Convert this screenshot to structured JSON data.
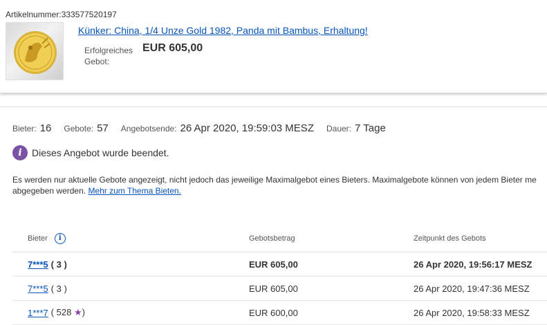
{
  "item": {
    "number_label": "Artikelnummer:",
    "number": "333577520197",
    "title": "Künker: China, 1/4 Unze Gold 1982, Panda mit Bambus, Erhaltung!",
    "winning_label": "Erfolgreiches Gebot:",
    "winning_price": "EUR 605,00"
  },
  "stats": {
    "bidders_label": "Bieter:",
    "bidders": "16",
    "bids_label": "Gebote:",
    "bids": "57",
    "end_label": "Angebotsende:",
    "end": "26 Apr 2020, 19:59:03 MESZ",
    "duration_label": "Dauer:",
    "duration": "7 Tage"
  },
  "ended_message": "Dieses Angebot wurde beendet.",
  "notice": {
    "line1": "Es werden nur aktuelle Gebote angezeigt, nicht jedoch das jeweilige Maximalgebot eines Bieters. Maximalgebote können von jedem Bieter me",
    "line2": "abgegeben werden.",
    "link": "Mehr zum Thema Bieten."
  },
  "table": {
    "headers": {
      "bidder": "Bieter",
      "amount": "Gebotsbetrag",
      "time": "Zeitpunkt des Gebots"
    },
    "rows": [
      {
        "bidder": "7***5",
        "score_open": "(",
        "score": "3",
        "score_close": ")",
        "star": "",
        "amount": "EUR 605,00",
        "time": "26 Apr 2020, 19:56:17 MESZ"
      },
      {
        "bidder": "7***5",
        "score_open": "(",
        "score": "3",
        "score_close": ")",
        "star": "",
        "amount": "EUR 605,00",
        "time": "26 Apr 2020, 19:47:36 MESZ"
      },
      {
        "bidder": "1***7",
        "score_open": "(",
        "score": "528",
        "score_close": ")",
        "star": "★",
        "amount": "EUR 600,00",
        "time": "26 Apr 2020, 19:58:33 MESZ"
      }
    ]
  },
  "colors": {
    "link": "#0654ba",
    "info_badge": "#7b53a6",
    "star": "#8a3fa8"
  }
}
